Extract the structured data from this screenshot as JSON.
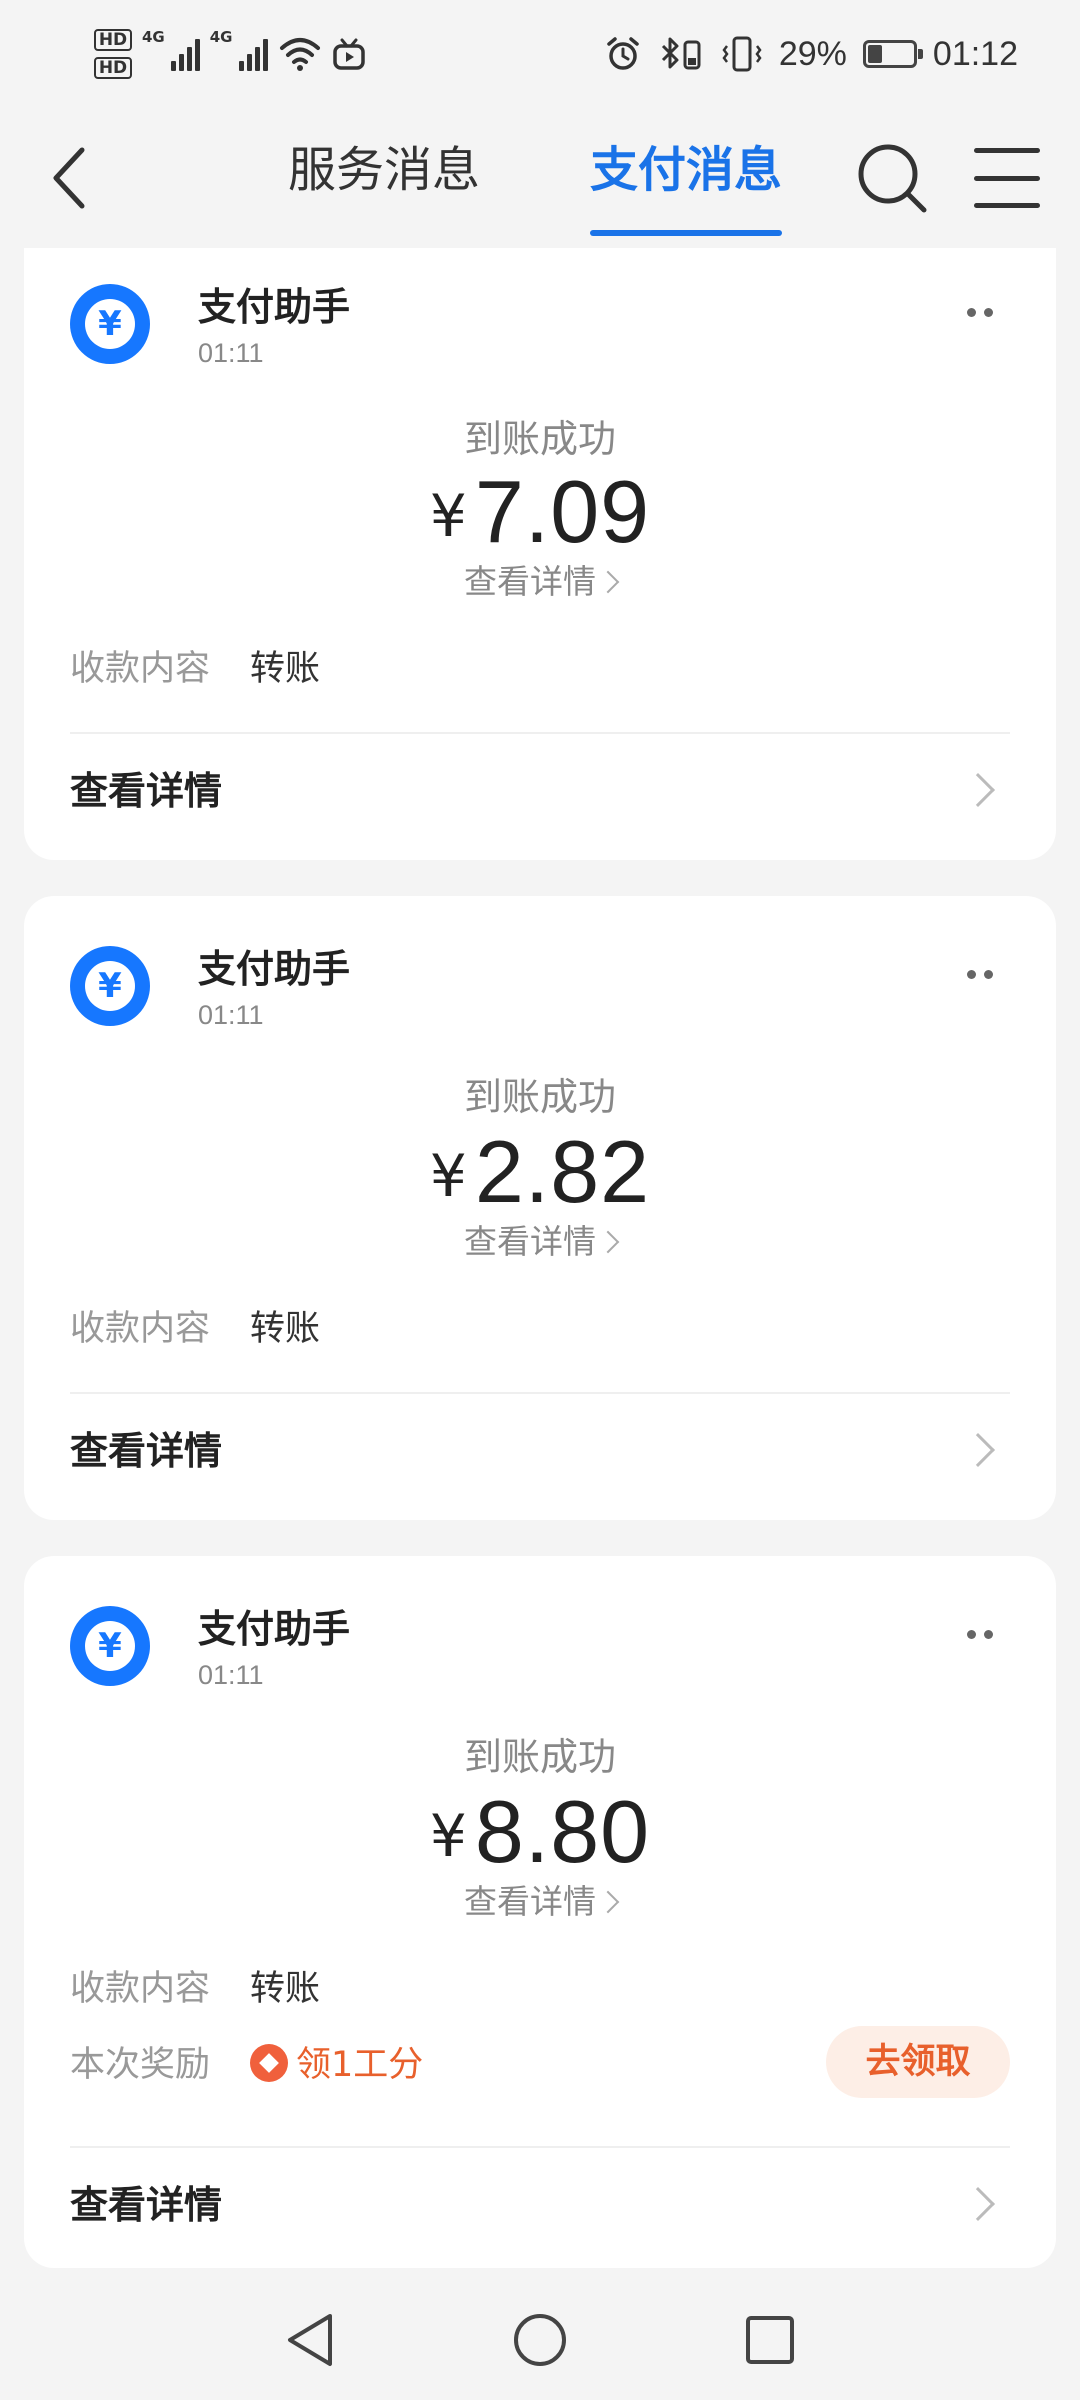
{
  "status_bar": {
    "hd1": "HD",
    "hd2": "HD",
    "net1": "4G",
    "net2": "4G",
    "battery_percent": "29%",
    "battery_level": 0.29,
    "time": "01:12"
  },
  "header": {
    "tabs": [
      {
        "label": "服务消息",
        "active": false
      },
      {
        "label": "支付消息",
        "active": true
      }
    ]
  },
  "accent_color": "#1a73e8",
  "messages": [
    {
      "sender": "支付助手",
      "time": "01:11",
      "status": "到账成功",
      "currency": "¥",
      "amount": "7.09",
      "detail_link": "查看详情",
      "content_label": "收款内容",
      "content_value": "转账",
      "footer_label": "查看详情"
    },
    {
      "sender": "支付助手",
      "time": "01:11",
      "status": "到账成功",
      "currency": "¥",
      "amount": "2.82",
      "detail_link": "查看详情",
      "content_label": "收款内容",
      "content_value": "转账",
      "footer_label": "查看详情"
    },
    {
      "sender": "支付助手",
      "time": "01:11",
      "status": "到账成功",
      "currency": "¥",
      "amount": "8.80",
      "detail_link": "查看详情",
      "content_label": "收款内容",
      "content_value": "转账",
      "reward_label": "本次奖励",
      "reward_value": "领1工分",
      "reward_button": "去领取",
      "footer_label": "查看详情"
    }
  ],
  "logo_glyph": "¥",
  "icons": {
    "back": "chevron-left-icon",
    "search": "search-icon",
    "menu": "menu-icon",
    "more": "more-dots-icon",
    "logo": "yuan-chat-icon",
    "reward": "reward-diamond-icon",
    "chevron": "chevron-right-icon"
  }
}
